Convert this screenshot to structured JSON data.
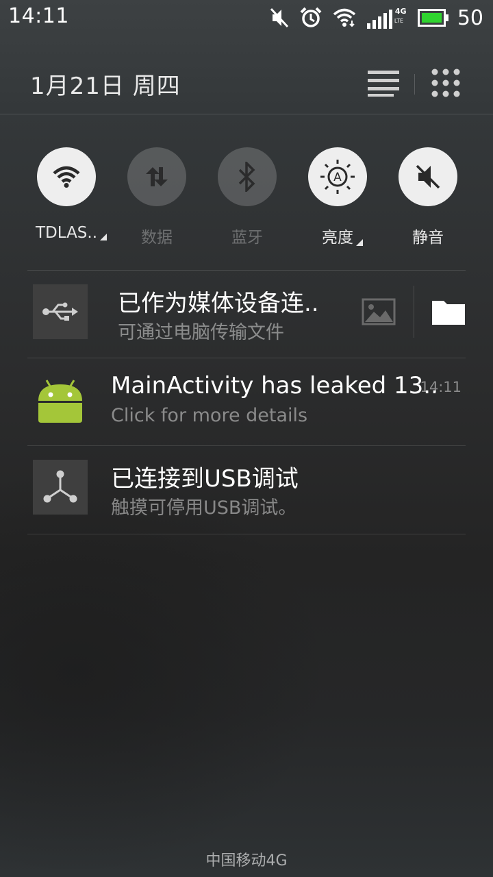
{
  "status_bar": {
    "time": "14:11",
    "icons": [
      "mute-icon",
      "alarm-icon",
      "wifi-icon",
      "signal-4g-icon",
      "battery-icon"
    ],
    "network_badge_top": "4G",
    "network_badge_bottom": "LTE",
    "battery_level": "50",
    "battery_color": "#2fd42f"
  },
  "header": {
    "date": "1月21日  周四",
    "icons": [
      "list-icon",
      "grid-icon"
    ]
  },
  "toggles": [
    {
      "label": "TDLAS..",
      "icon": "wifi-icon",
      "active": true,
      "has_menu": true
    },
    {
      "label": "数据",
      "icon": "data-icon",
      "active": false,
      "has_menu": false
    },
    {
      "label": "蓝牙",
      "icon": "bluetooth-icon",
      "active": false,
      "has_menu": false
    },
    {
      "label": "亮度",
      "icon": "brightness-icon",
      "active": true,
      "has_menu": true
    },
    {
      "label": "静音",
      "icon": "mute-icon",
      "active": true,
      "has_menu": false
    }
  ],
  "notifications": [
    {
      "title": "已作为媒体设备连..",
      "subtitle": "可通过电脑传输文件",
      "icon": "usb-icon",
      "actions": [
        "image-icon",
        "folder-icon"
      ]
    },
    {
      "title": "MainActivity has leaked 13..",
      "subtitle": "Click for more details",
      "time": "14:11",
      "icon": "android-icon"
    },
    {
      "title": "已连接到USB调试",
      "subtitle": "触摸可停用USB调试。",
      "icon": "debug-icon"
    }
  ],
  "carrier": "中国移动4G",
  "colors": {
    "android_green": "#a4c639",
    "toggle_on": "#eeeeee"
  }
}
